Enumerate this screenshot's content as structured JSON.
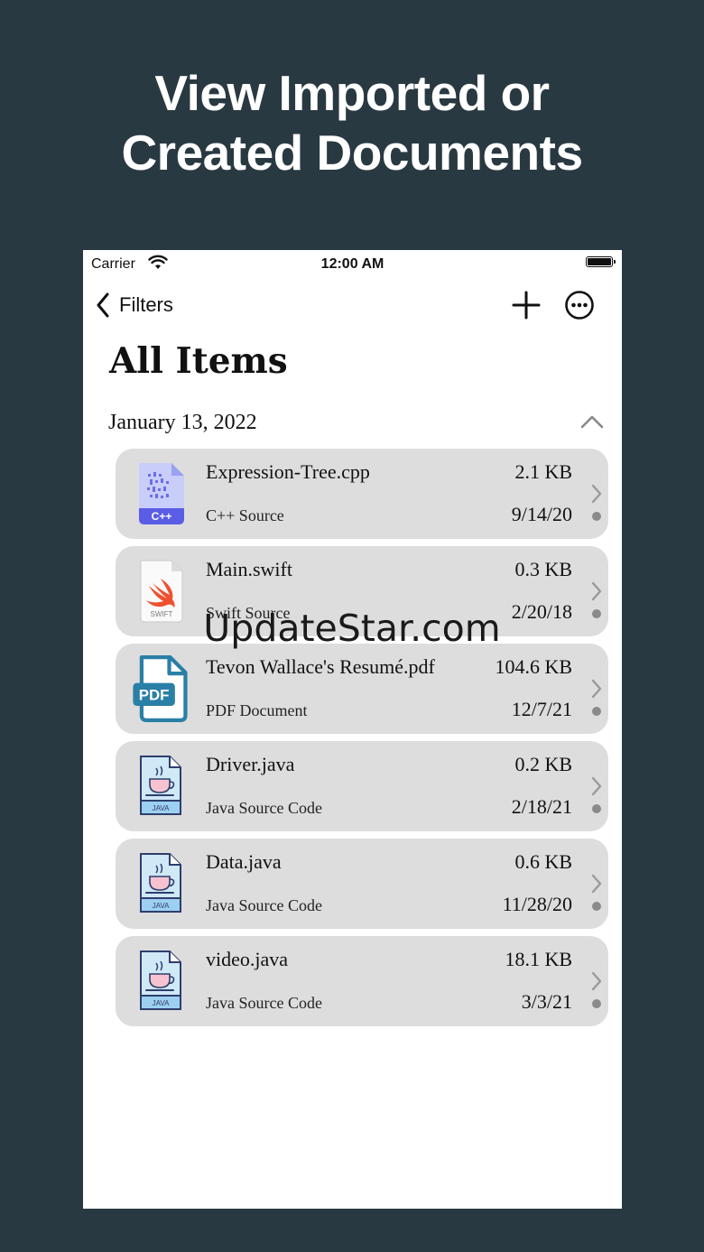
{
  "headline": {
    "line1": "View Imported or",
    "line2": "Created Documents"
  },
  "status_bar": {
    "carrier": "Carrier",
    "time": "12:00 AM",
    "wifi_icon": "wifi-icon",
    "battery_icon": "battery-icon"
  },
  "nav": {
    "back_label": "Filters",
    "back_icon": "chevron-left-icon",
    "add_icon": "plus-icon",
    "more_icon": "ellipsis-circle-icon"
  },
  "page_title": "All Items",
  "section": {
    "date": "January 13, 2022",
    "collapse_icon": "chevron-up-icon"
  },
  "files": [
    {
      "name": "Expression-Tree.cpp",
      "kind": "C++ Source",
      "size": "2.1 KB",
      "date": "9/14/20",
      "icon": "cpp-file-icon"
    },
    {
      "name": "Main.swift",
      "kind": "Swift Source",
      "size": "0.3 KB",
      "date": "2/20/18",
      "icon": "swift-file-icon"
    },
    {
      "name": "Tevon Wallace's Resumé.pdf",
      "kind": "PDF Document",
      "size": "104.6 KB",
      "date": "12/7/21",
      "icon": "pdf-file-icon"
    },
    {
      "name": "Driver.java",
      "kind": "Java Source Code",
      "size": "0.2 KB",
      "date": "2/18/21",
      "icon": "java-file-icon"
    },
    {
      "name": "Data.java",
      "kind": "Java Source Code",
      "size": "0.6 KB",
      "date": "11/28/20",
      "icon": "java-file-icon"
    },
    {
      "name": "video.java",
      "kind": "Java Source Code",
      "size": "18.1 KB",
      "date": "3/3/21",
      "icon": "java-file-icon"
    }
  ],
  "icon_labels": {
    "cpp": "C++",
    "swift": "SWIFT",
    "pdf": "PDF",
    "java": "JAVA"
  },
  "watermark": "UpdateStar.com",
  "colors": {
    "background": "#293941",
    "row": "#dddddd",
    "cpp_accent": "#5b5ce6",
    "swift_accent": "#f0502f",
    "pdf_accent": "#2a7fa6",
    "java_paper": "#cfe9f7"
  }
}
